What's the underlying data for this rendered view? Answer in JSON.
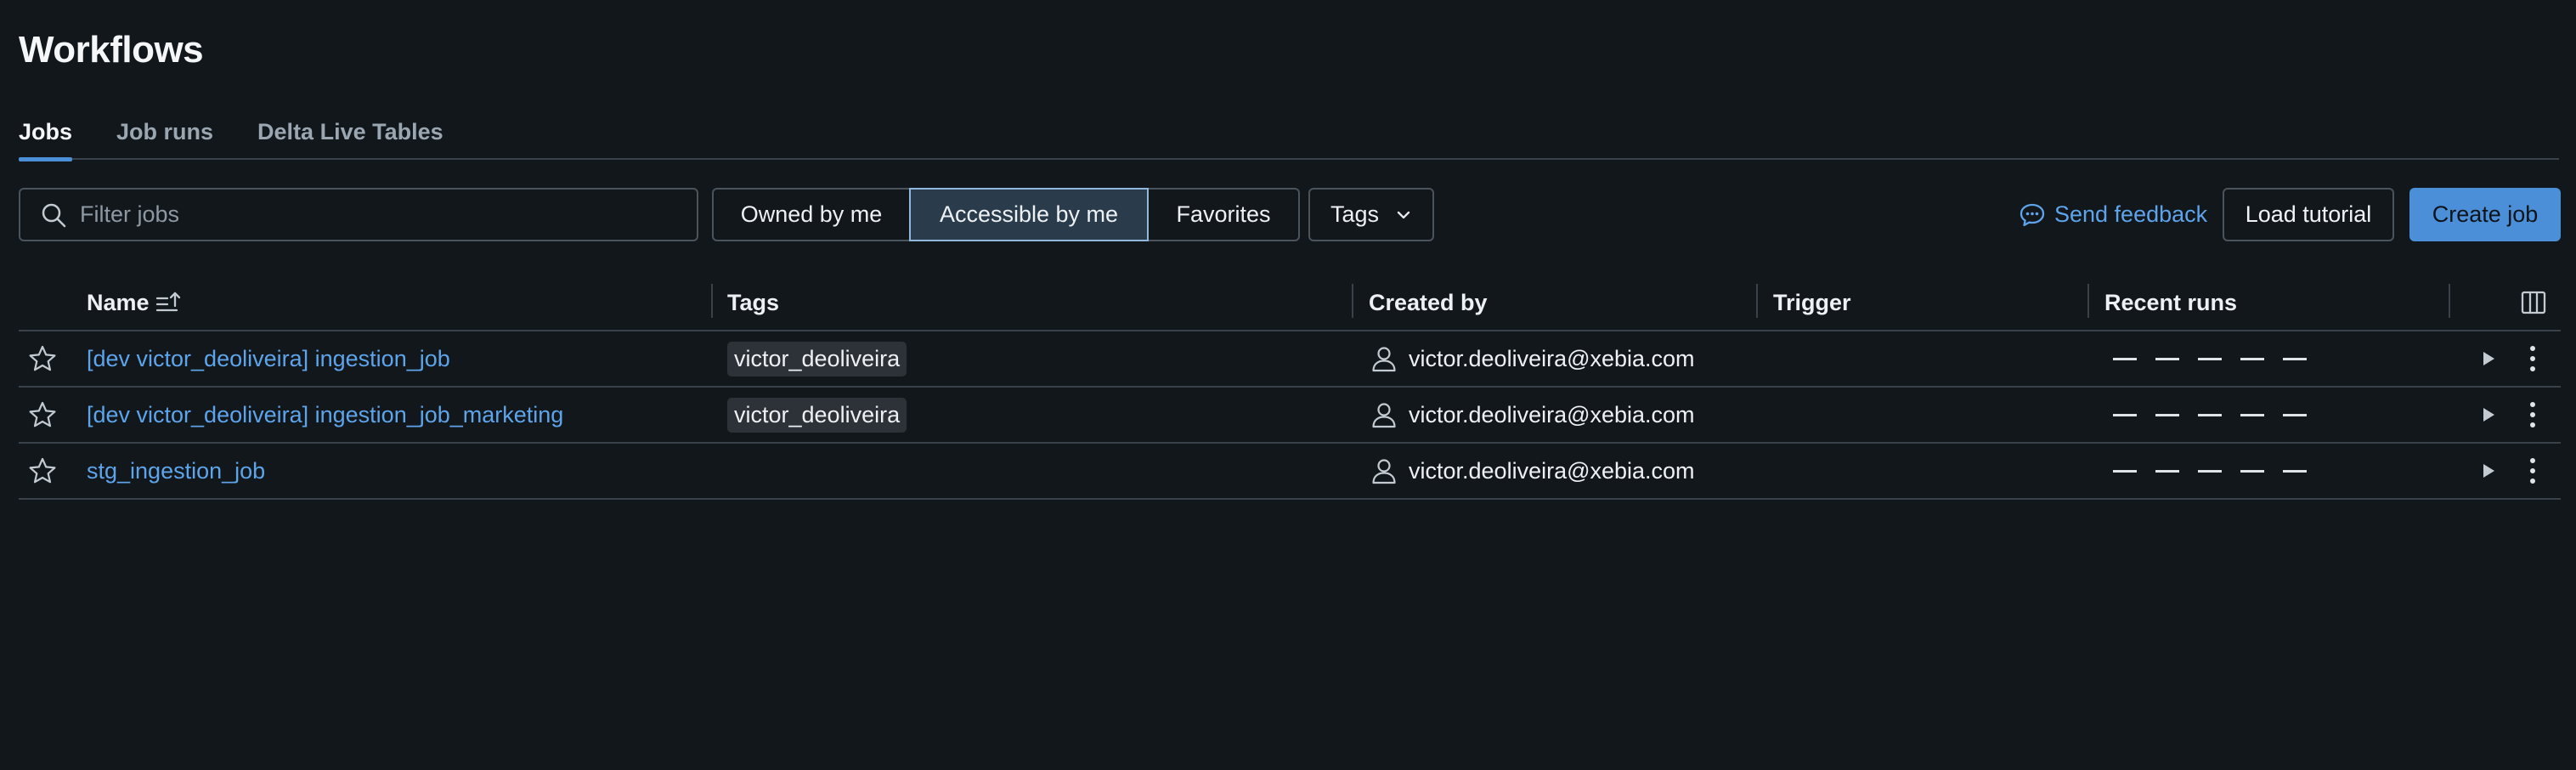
{
  "page": {
    "title": "Workflows"
  },
  "tabs": [
    {
      "label": "Jobs",
      "active": true
    },
    {
      "label": "Job runs",
      "active": false
    },
    {
      "label": "Delta Live Tables",
      "active": false
    }
  ],
  "toolbar": {
    "search_placeholder": "Filter jobs",
    "filters": [
      "Owned by me",
      "Accessible by me",
      "Favorites"
    ],
    "selected_filter": "Accessible by me",
    "tags_label": "Tags",
    "feedback_label": "Send feedback",
    "load_tutorial_label": "Load tutorial",
    "create_job_label": "Create job"
  },
  "table": {
    "columns": [
      "Name",
      "Tags",
      "Created by",
      "Trigger",
      "Recent runs"
    ],
    "rows": [
      {
        "name": "[dev victor_deoliveira] ingestion_job",
        "tag": "victor_deoliveira",
        "created_by": "victor.deoliveira@xebia.com",
        "trigger": ""
      },
      {
        "name": "[dev victor_deoliveira] ingestion_job_marketing",
        "tag": "victor_deoliveira",
        "created_by": "victor.deoliveira@xebia.com",
        "trigger": ""
      },
      {
        "name": "stg_ingestion_job",
        "tag": "",
        "created_by": "victor.deoliveira@xebia.com",
        "trigger": ""
      }
    ]
  },
  "colors": {
    "accent": "#4b8fd8",
    "link": "#5ea4ea",
    "background": "#12171c"
  },
  "icons": [
    "search-icon",
    "chevron-down-icon",
    "feedback-icon",
    "sort-icon",
    "columns-icon",
    "star-icon",
    "user-icon",
    "play-icon",
    "kebab-icon"
  ]
}
